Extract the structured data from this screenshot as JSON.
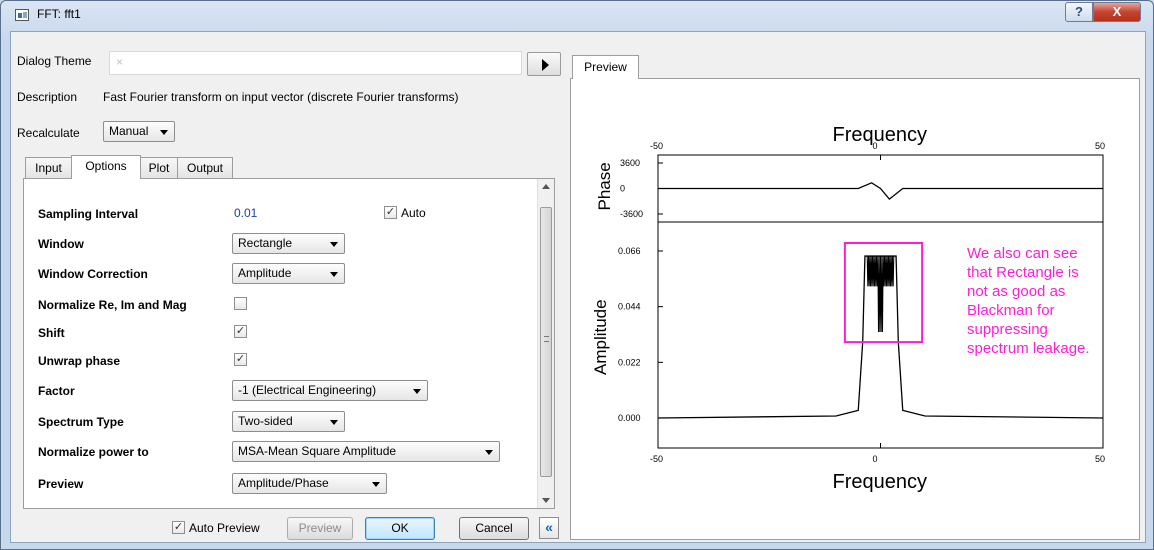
{
  "window": {
    "title": "FFT: fft1",
    "help_glyph": "?",
    "close_glyph": "X"
  },
  "dialog_theme": {
    "label": "Dialog Theme",
    "value": "",
    "clear_glyph": "×"
  },
  "description": {
    "label": "Description",
    "text": "Fast Fourier transform on input vector (discrete Fourier transforms)"
  },
  "recalculate": {
    "label": "Recalculate",
    "value": "Manual"
  },
  "tabs": [
    {
      "label": "Input"
    },
    {
      "label": "Options",
      "active": true
    },
    {
      "label": "Plot"
    },
    {
      "label": "Output"
    }
  ],
  "options": {
    "sampling_interval": {
      "label": "Sampling Interval",
      "value": "0.01",
      "auto_label": "Auto",
      "auto_checked": true
    },
    "window": {
      "label": "Window",
      "value": "Rectangle"
    },
    "window_correction": {
      "label": "Window Correction",
      "value": "Amplitude"
    },
    "normalize": {
      "label": "Normalize Re, Im and Mag",
      "checked": false
    },
    "shift": {
      "label": "Shift",
      "checked": true
    },
    "unwrap": {
      "label": "Unwrap phase",
      "checked": true
    },
    "factor": {
      "label": "Factor",
      "value": "-1 (Electrical Engineering)"
    },
    "spectrum_type": {
      "label": "Spectrum Type",
      "value": "Two-sided"
    },
    "normalize_power": {
      "label": "Normalize power to",
      "value": "MSA-Mean Square Amplitude"
    },
    "preview": {
      "label": "Preview",
      "value": "Amplitude/Phase"
    }
  },
  "footer": {
    "auto_preview_label": "Auto Preview",
    "auto_preview_checked": true,
    "preview_button": "Preview",
    "ok_button": "OK",
    "cancel_button": "Cancel",
    "collapse_glyph": "«"
  },
  "preview_tab": {
    "label": "Preview"
  },
  "annotation": "We also can see that Rectangle is not as good as Blackman for suppressing spectrum leakage.",
  "chart_data": [
    {
      "type": "line",
      "title": "Frequency",
      "ylabel": "Phase",
      "x_ticks": [
        "-50",
        "0",
        "50"
      ],
      "y_ticks": [
        "3600",
        "0",
        "-3600"
      ],
      "xlim": [
        -50,
        50
      ],
      "ylim": [
        -3600,
        3600
      ],
      "series": [
        {
          "values_description_free": true,
          "x": [
            -50,
            -5,
            -2,
            0,
            2,
            5,
            50
          ],
          "y": [
            0,
            0,
            800,
            0,
            -1500,
            0,
            0
          ]
        }
      ]
    },
    {
      "type": "line",
      "xlabel": "Frequency",
      "ylabel": "Amplitude",
      "x_ticks": [
        "-50",
        "0",
        "50"
      ],
      "y_ticks": [
        "0.066",
        "0.044",
        "0.022",
        "0.000"
      ],
      "xlim": [
        -50,
        50
      ],
      "ylim": [
        0,
        0.066
      ],
      "series": [
        {
          "x": [
            -50,
            -10,
            -5,
            -4,
            -3.5,
            -3,
            3,
            3.5,
            4,
            5,
            10,
            50
          ],
          "y": [
            0,
            0.0008,
            0.003,
            0.03,
            0.064,
            0.064,
            0.064,
            0.064,
            0.03,
            0.003,
            0.0008,
            0
          ]
        }
      ]
    }
  ],
  "colors": {
    "annotation": "#ff1ed7",
    "highlight_box": "#ff1ed7",
    "link_blue": "#1a3fb0"
  }
}
